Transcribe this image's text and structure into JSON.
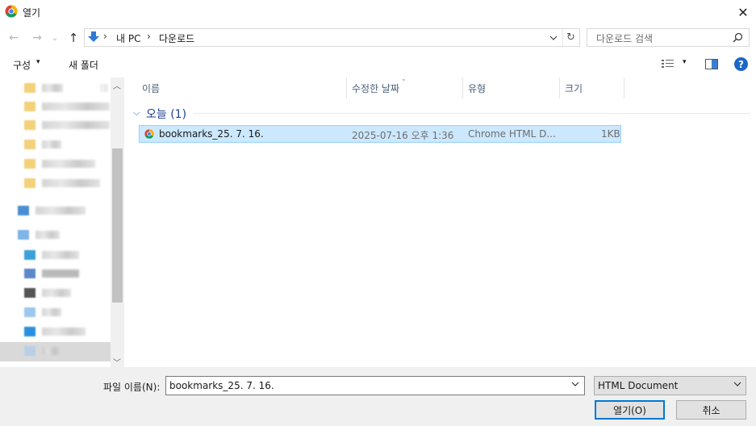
{
  "window": {
    "title": "열기",
    "close_glyph": "✕"
  },
  "nav": {
    "back_glyph": "←",
    "forward_glyph": "→",
    "recent_glyph": "⌄",
    "up_glyph": "↑",
    "breadcrumb": [
      "내 PC",
      "다운로드"
    ],
    "breadcrumb_sep": "›",
    "refresh_glyph": "↻",
    "search_placeholder": "다운로드 검색"
  },
  "toolbar": {
    "organize_label": "구성",
    "caret": "▾",
    "new_folder_label": "새 폴더"
  },
  "columns": {
    "name": "이름",
    "date": "수정한 날짜",
    "type": "유형",
    "size": "크기"
  },
  "group": {
    "label": "오늘 (1)"
  },
  "files": [
    {
      "name": "bookmarks_25. 7. 16.",
      "date": "2025-07-16 오후 1:36",
      "type": "Chrome HTML D...",
      "size": "1KB"
    }
  ],
  "bottom": {
    "filename_label": "파일 이름(N):",
    "filename_value": "bookmarks_25. 7. 16.",
    "filetype_value": "HTML Document",
    "open_label": "열기(O)",
    "cancel_label": "취소"
  },
  "colors": {
    "accent": "#0078d7",
    "selection": "#cce8ff",
    "help": "#1c66c7"
  },
  "icons": [
    "chrome-icon",
    "close-icon",
    "back-arrow-icon",
    "forward-arrow-icon",
    "up-arrow-icon",
    "download-folder-icon",
    "refresh-icon",
    "search-icon",
    "view-options-icon",
    "preview-pane-icon",
    "help-icon"
  ]
}
